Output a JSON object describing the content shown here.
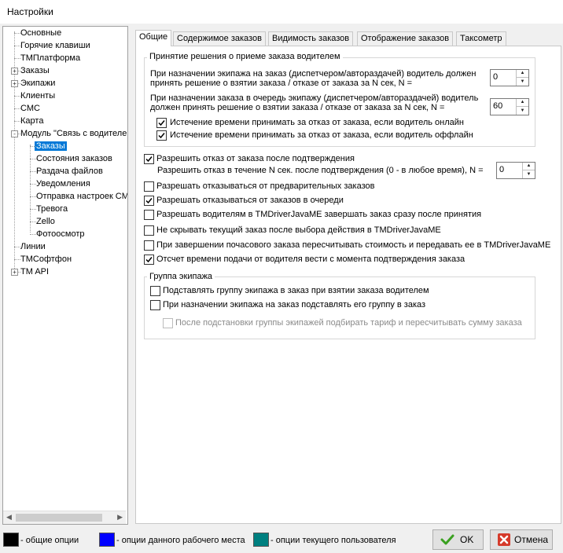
{
  "window": {
    "title": "Настройки"
  },
  "tree": {
    "items": [
      {
        "label": "Основные"
      },
      {
        "label": "Горячие клавиши"
      },
      {
        "label": "ТМПлатформа"
      },
      {
        "label": "Заказы",
        "expander": "+"
      },
      {
        "label": "Экипажи",
        "expander": "+"
      },
      {
        "label": "Клиенты"
      },
      {
        "label": "СМС"
      },
      {
        "label": "Карта"
      },
      {
        "label": "Модуль \"Связь с водителем\"",
        "expander": "-"
      },
      {
        "label": "Заказы",
        "selected": true
      },
      {
        "label": "Состояния заказов"
      },
      {
        "label": "Раздача файлов"
      },
      {
        "label": "Уведомления"
      },
      {
        "label": "Отправка настроек CM"
      },
      {
        "label": "Тревога"
      },
      {
        "label": "Zello"
      },
      {
        "label": "Фотоосмотр"
      },
      {
        "label": "Линии"
      },
      {
        "label": "ТМСофтфон"
      },
      {
        "label": "TM API",
        "expander": "+"
      }
    ]
  },
  "tabs": [
    "Общие",
    "Содержимое заказов",
    "Видимость заказов",
    "Отображение заказов",
    "Таксометр"
  ],
  "group1": {
    "title": "Принятие решения о приеме заказа водителем",
    "line1a": "При назначении экипажа на заказ (диспетчером/автораздачей) водитель должен",
    "line1b": "принять решение о взятии заказа / отказе от заказа за N сек, N =",
    "spin1": "0",
    "line2a": "При назначении заказа в очередь экипажу (диспетчером/автораздачей) водитель",
    "line2b": "должен принять решение о взятии заказа / отказе от заказа за N сек, N =",
    "spin2": "60",
    "cb_online": "Истечение времени принимать за отказ от заказа, если водитель онлайн",
    "cb_offline": "Истечение времени принимать за отказ от заказа, если водитель оффлайн"
  },
  "options": {
    "allow_refuse": "Разрешить отказ от заказа после подтверждения",
    "allow_refuse_n": "Разрешить отказ в течение N сек. после подтверждения (0 - в любое время), N =",
    "spin3": "0",
    "refuse_prelim": "Разрешать отказываться от предварительных заказов",
    "refuse_queue": "Разрешать отказываться от заказов в очереди",
    "finish_after_accept": "Разрешать водителям в TMDriverJavaME завершать заказ сразу после принятия",
    "keep_current": "Не скрывать текущий заказ после  выбора действия в TMDriverJavaME",
    "hourly_recalc": "При завершении почасового заказа пересчитывать стоимость и передавать ее в TMDriverJavaME",
    "countdown_from_confirm": "Отсчет времени подачи от водителя вести с момента подтверждения заказа"
  },
  "crew_group": {
    "title": "Группа экипажа",
    "sub_on_take": "Подставлять группу экипажа в заказ при взятии заказа водителем",
    "sub_on_assign": "При назначении экипажа на заказ подставлять его группу в заказ",
    "tariff_recalc": "После подстановки группы экипажей подбирать тариф и пересчитывать сумму заказа"
  },
  "legend": {
    "general": "- общие опции",
    "workplace": "- опции данного рабочего места",
    "user": "- опции текущего пользователя",
    "colors": {
      "general": "#000000",
      "workplace": "#0000ff",
      "user": "#008080"
    }
  },
  "buttons": {
    "ok": "OK",
    "cancel": "Отмена"
  }
}
